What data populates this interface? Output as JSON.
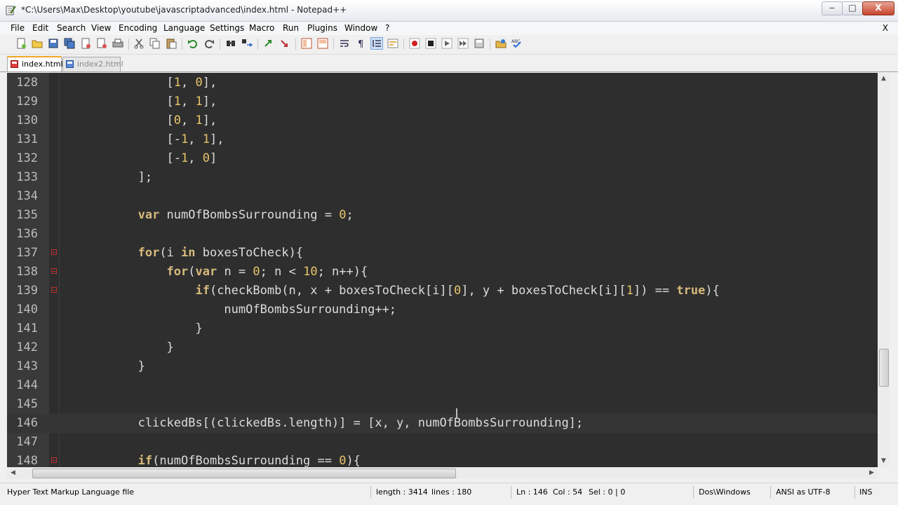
{
  "window": {
    "title": "*C:\\Users\\Max\\Desktop\\youtube\\javascriptadvanced\\index.html - Notepad++",
    "minimize_label": "‒",
    "maximize_label": "□",
    "close_label": "X"
  },
  "menu": {
    "items": [
      "File",
      "Edit",
      "Search",
      "View",
      "Encoding",
      "Language",
      "Settings",
      "Macro",
      "Run",
      "Plugins",
      "Window",
      "?"
    ],
    "close_doc_label": "X"
  },
  "tabs": [
    {
      "label": "index.html",
      "active": true
    },
    {
      "label": "index2.html",
      "active": false
    }
  ],
  "editor": {
    "current_line": 146,
    "lines": [
      {
        "num": "128",
        "fold": false,
        "tokens": [
          [
            "tx",
            "               ["
          ],
          [
            "num",
            "1"
          ],
          [
            "tx",
            ", "
          ],
          [
            "num",
            "0"
          ],
          [
            "tx",
            "],"
          ]
        ]
      },
      {
        "num": "129",
        "fold": false,
        "tokens": [
          [
            "tx",
            "               ["
          ],
          [
            "num",
            "1"
          ],
          [
            "tx",
            ", "
          ],
          [
            "num",
            "1"
          ],
          [
            "tx",
            "],"
          ]
        ]
      },
      {
        "num": "130",
        "fold": false,
        "tokens": [
          [
            "tx",
            "               ["
          ],
          [
            "num",
            "0"
          ],
          [
            "tx",
            ", "
          ],
          [
            "num",
            "1"
          ],
          [
            "tx",
            "],"
          ]
        ]
      },
      {
        "num": "131",
        "fold": false,
        "tokens": [
          [
            "tx",
            "               [-"
          ],
          [
            "num",
            "1"
          ],
          [
            "tx",
            ", "
          ],
          [
            "num",
            "1"
          ],
          [
            "tx",
            "],"
          ]
        ]
      },
      {
        "num": "132",
        "fold": false,
        "tokens": [
          [
            "tx",
            "               [-"
          ],
          [
            "num",
            "1"
          ],
          [
            "tx",
            ", "
          ],
          [
            "num",
            "0"
          ],
          [
            "tx",
            "]"
          ]
        ]
      },
      {
        "num": "133",
        "fold": false,
        "tokens": [
          [
            "tx",
            "           ];"
          ]
        ]
      },
      {
        "num": "134",
        "fold": false,
        "tokens": []
      },
      {
        "num": "135",
        "fold": false,
        "tokens": [
          [
            "tx",
            "           "
          ],
          [
            "kw",
            "var"
          ],
          [
            "tx",
            " numOfBombsSurrounding = "
          ],
          [
            "num",
            "0"
          ],
          [
            "tx",
            ";"
          ]
        ]
      },
      {
        "num": "136",
        "fold": false,
        "tokens": []
      },
      {
        "num": "137",
        "fold": true,
        "tokens": [
          [
            "tx",
            "           "
          ],
          [
            "kw",
            "for"
          ],
          [
            "tx",
            "(i "
          ],
          [
            "kw",
            "in"
          ],
          [
            "tx",
            " boxesToCheck){"
          ]
        ]
      },
      {
        "num": "138",
        "fold": true,
        "tokens": [
          [
            "tx",
            "               "
          ],
          [
            "kw",
            "for"
          ],
          [
            "tx",
            "("
          ],
          [
            "kw",
            "var"
          ],
          [
            "tx",
            " n = "
          ],
          [
            "num",
            "0"
          ],
          [
            "tx",
            "; n < "
          ],
          [
            "num",
            "10"
          ],
          [
            "tx",
            "; n++){"
          ]
        ]
      },
      {
        "num": "139",
        "fold": true,
        "tokens": [
          [
            "tx",
            "                   "
          ],
          [
            "kw",
            "if"
          ],
          [
            "tx",
            "(checkBomb(n, x + boxesToCheck[i]["
          ],
          [
            "num",
            "0"
          ],
          [
            "tx",
            "], y + boxesToCheck[i]["
          ],
          [
            "num",
            "1"
          ],
          [
            "tx",
            "]) == "
          ],
          [
            "kw",
            "true"
          ],
          [
            "tx",
            "){"
          ]
        ]
      },
      {
        "num": "140",
        "fold": false,
        "tokens": [
          [
            "tx",
            "                       numOfBombsSurrounding++;"
          ]
        ]
      },
      {
        "num": "141",
        "fold": false,
        "tokens": [
          [
            "tx",
            "                   }"
          ]
        ]
      },
      {
        "num": "142",
        "fold": false,
        "tokens": [
          [
            "tx",
            "               }"
          ]
        ]
      },
      {
        "num": "143",
        "fold": false,
        "tokens": [
          [
            "tx",
            "           }"
          ]
        ]
      },
      {
        "num": "144",
        "fold": false,
        "tokens": []
      },
      {
        "num": "145",
        "fold": false,
        "tokens": []
      },
      {
        "num": "146",
        "fold": false,
        "tokens": [
          [
            "tx",
            "           clickedBs[(clickedBs.length)] = [x, y, numOfBombsSurrounding];"
          ]
        ]
      },
      {
        "num": "147",
        "fold": false,
        "tokens": []
      },
      {
        "num": "148",
        "fold": true,
        "tokens": [
          [
            "tx",
            "           "
          ],
          [
            "kw",
            "if"
          ],
          [
            "tx",
            "(numOfBombsSurrounding == "
          ],
          [
            "num",
            "0"
          ],
          [
            "tx",
            "){"
          ]
        ]
      }
    ]
  },
  "status": {
    "file_type": "Hyper Text Markup Language file",
    "length": "length : 3414",
    "lines": "lines : 180",
    "ln": "Ln : 146",
    "col": "Col : 54",
    "sel": "Sel : 0 | 0",
    "eol": "Dos\\Windows",
    "encoding": "ANSI as UTF-8",
    "mode": "INS"
  },
  "colors": {
    "editor_bg": "#2e2e2e",
    "keyword": "#d7ba7d",
    "number": "#e8c46a",
    "text": "#dcdcdc",
    "tab_accent": "#f5a623"
  },
  "scroll": {
    "vertical_position": 0.71,
    "horizontal_visible_fraction": 0.5
  }
}
